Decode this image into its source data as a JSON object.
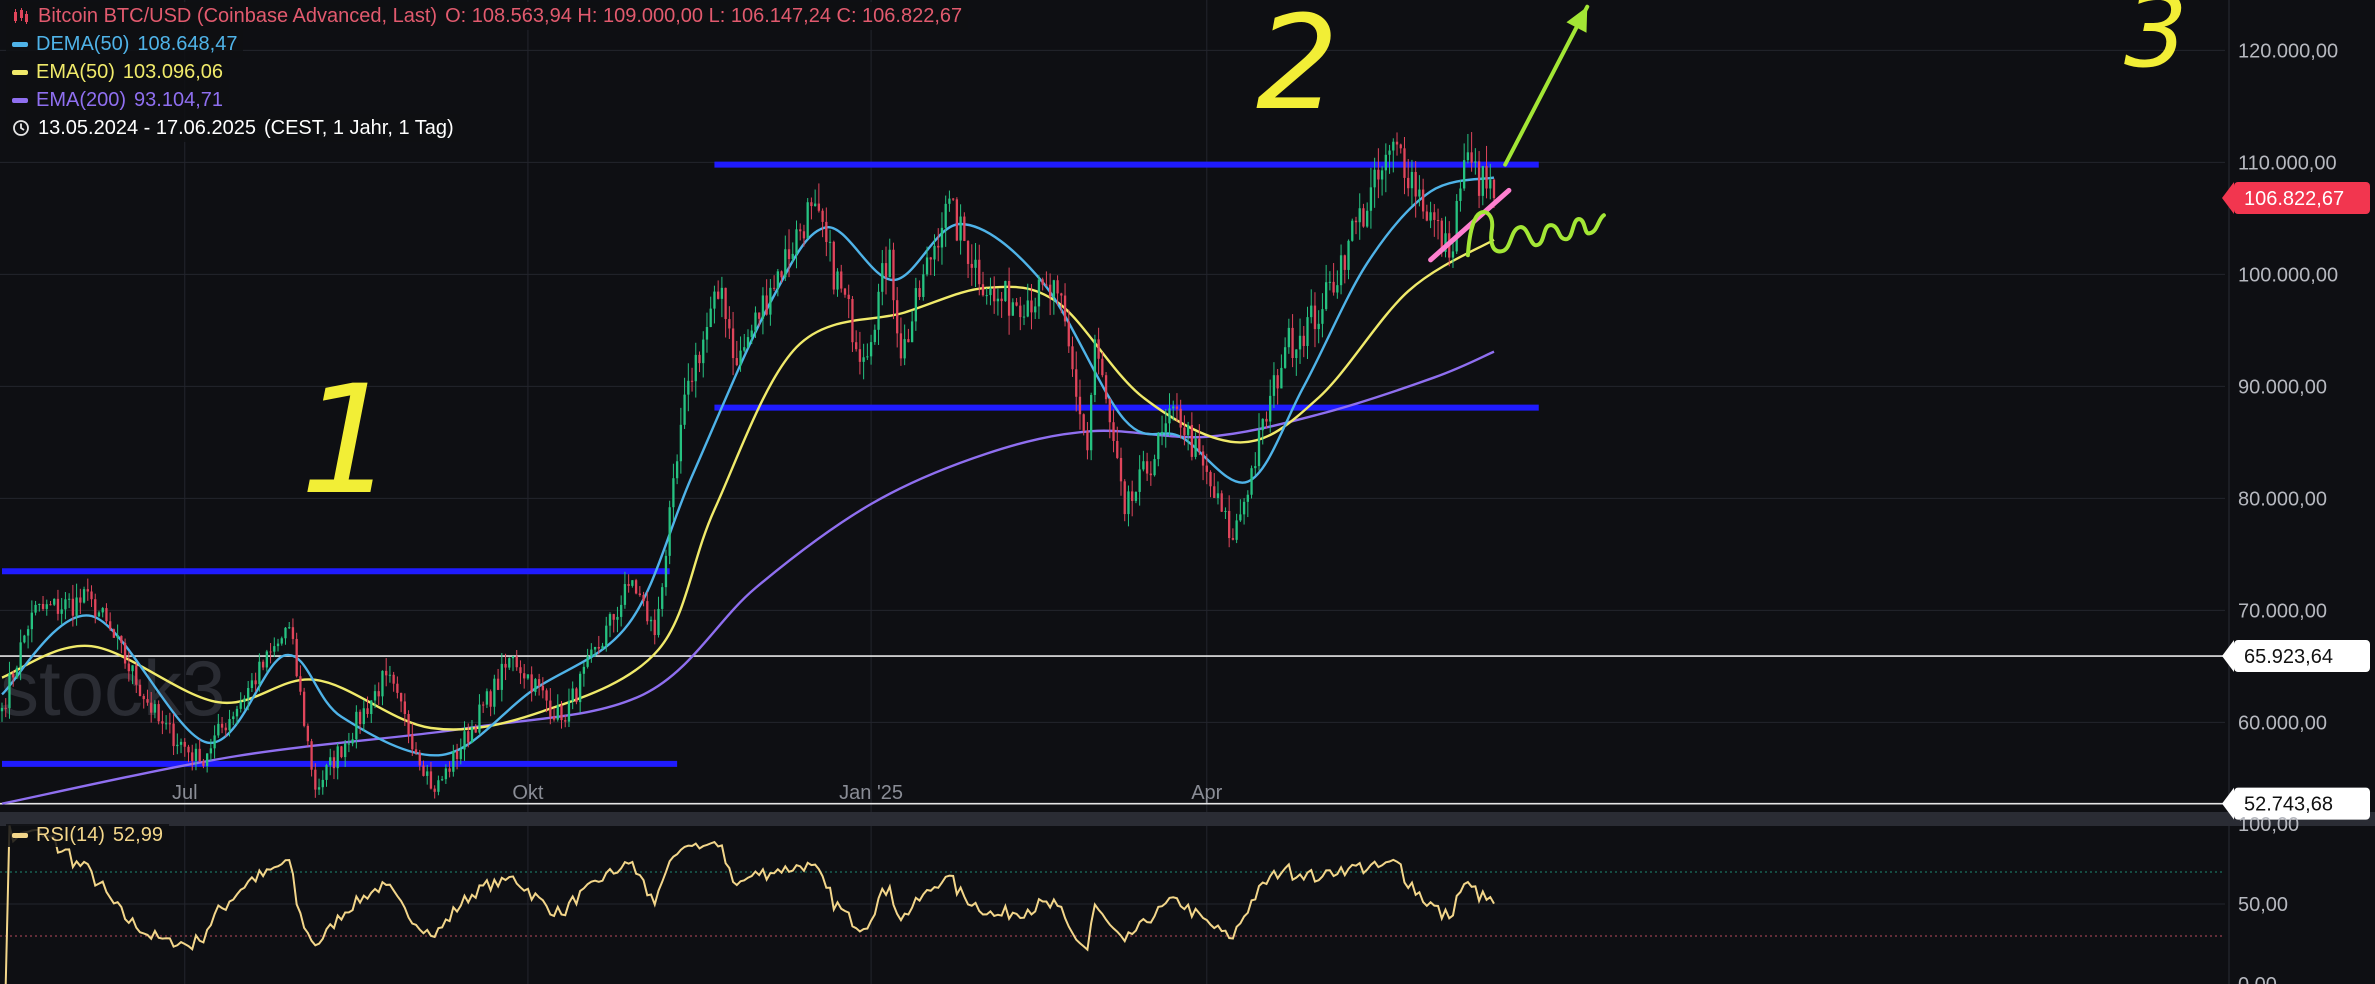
{
  "header": {
    "symbol": "Bitcoin BTC/USD (Coinbase Advanced, Last)",
    "ohlc": "O: 108.563,94  H: 109.000,00  L: 106.147,24  C: 106.822,67",
    "range": "13.05.2024 - 17.06.2025",
    "range_meta": "(CEST, 1 Jahr, 1 Tag)"
  },
  "indicators": [
    {
      "name": "DEMA(50)",
      "value": "108.648,47",
      "color": "#4fb3e8"
    },
    {
      "name": "EMA(50)",
      "value": "103.096,06",
      "color": "#f0ea6a"
    },
    {
      "name": "EMA(200)",
      "value": "93.104,71",
      "color": "#8f6ff0"
    }
  ],
  "rsi": {
    "name": "RSI(14)",
    "value": "52,99",
    "color": "#f3d68a"
  },
  "colors": {
    "up": "#26c281",
    "down": "#e0455b",
    "hline": "#1f1bff",
    "trend": "#ff7fd0",
    "arrow": "#a3e635"
  },
  "annotations": {
    "wave1": "1",
    "wave2": "2",
    "wave3": "3"
  },
  "watermark": "stock3",
  "chart_data": {
    "type": "candlestick",
    "title": "Bitcoin BTC/USD (Coinbase Advanced, Last)",
    "x_labels": [
      "Jul",
      "Okt",
      "Jan '25",
      "Apr"
    ],
    "y_labels": [
      "120.000,00",
      "110.000,00",
      "100.000,00",
      "90.000,00",
      "80.000,00",
      "70.000,00",
      "60.000,00"
    ],
    "ylim": [
      52000,
      124500
    ],
    "price_tags": [
      {
        "label": "106.822,67",
        "value": 106822.67,
        "highlight": true
      },
      {
        "label": "65.923,64",
        "value": 65923.64
      },
      {
        "label": "52.743,68",
        "value": 52743.68
      }
    ],
    "horizontal_levels": [
      {
        "value": 73500,
        "from": "2024-05-13",
        "to": "2024-11-08"
      },
      {
        "value": 56300,
        "from": "2024-05-13",
        "to": "2024-11-10"
      },
      {
        "value": 109800,
        "from": "2024-11-20",
        "to": "2025-06-29"
      },
      {
        "value": 88100,
        "from": "2024-11-20",
        "to": "2025-06-29"
      }
    ],
    "trendline": {
      "start": [
        "2025-05-31",
        101300
      ],
      "end": [
        "2025-06-21",
        107500
      ]
    },
    "arrow": {
      "start": [
        "2025-06-20",
        109800
      ],
      "end": [
        "2025-07-12",
        123900
      ]
    },
    "anchors": [
      {
        "date": "2024-05-13",
        "close": 61300
      },
      {
        "date": "2024-05-21",
        "close": 69800
      },
      {
        "date": "2024-06-06",
        "close": 71000
      },
      {
        "date": "2024-06-24",
        "close": 60100
      },
      {
        "date": "2024-07-05",
        "close": 56500
      },
      {
        "date": "2024-07-29",
        "close": 68500
      },
      {
        "date": "2024-08-05",
        "close": 54000
      },
      {
        "date": "2024-08-24",
        "close": 64200
      },
      {
        "date": "2024-09-06",
        "close": 53800
      },
      {
        "date": "2024-09-27",
        "close": 65900
      },
      {
        "date": "2024-10-10",
        "close": 60200
      },
      {
        "date": "2024-10-29",
        "close": 72700
      },
      {
        "date": "2024-11-04",
        "close": 67800
      },
      {
        "date": "2024-11-13",
        "close": 90500
      },
      {
        "date": "2024-11-22",
        "close": 98800
      },
      {
        "date": "2024-11-26",
        "close": 91900
      },
      {
        "date": "2024-12-05",
        "close": 98800
      },
      {
        "date": "2024-12-16",
        "close": 106100
      },
      {
        "date": "2024-12-30",
        "close": 92600
      },
      {
        "date": "2025-01-06",
        "close": 102200
      },
      {
        "date": "2025-01-09",
        "close": 92500
      },
      {
        "date": "2025-01-21",
        "close": 106300
      },
      {
        "date": "2025-02-03",
        "close": 97600
      },
      {
        "date": "2025-02-20",
        "close": 98300
      },
      {
        "date": "2025-02-28",
        "close": 84300
      },
      {
        "date": "2025-03-02",
        "close": 94200
      },
      {
        "date": "2025-03-10",
        "close": 78600
      },
      {
        "date": "2025-03-24",
        "close": 88000
      },
      {
        "date": "2025-04-08",
        "close": 76300
      },
      {
        "date": "2025-04-22",
        "close": 93500
      },
      {
        "date": "2025-05-02",
        "close": 96900
      },
      {
        "date": "2025-05-09",
        "close": 103000
      },
      {
        "date": "2025-05-22",
        "close": 111600
      },
      {
        "date": "2025-06-05",
        "close": 101500
      },
      {
        "date": "2025-06-09",
        "close": 110200
      },
      {
        "date": "2025-06-17",
        "close": 106822.67
      }
    ],
    "dema50_points": [
      {
        "date": "2024-05-13",
        "value": 62500
      },
      {
        "date": "2024-06-06",
        "value": 69500
      },
      {
        "date": "2024-07-07",
        "value": 58200
      },
      {
        "date": "2024-07-28",
        "value": 66000
      },
      {
        "date": "2024-08-12",
        "value": 60500
      },
      {
        "date": "2024-09-08",
        "value": 57100
      },
      {
        "date": "2024-10-02",
        "value": 62800
      },
      {
        "date": "2024-10-28",
        "value": 68800
      },
      {
        "date": "2024-11-14",
        "value": 82000
      },
      {
        "date": "2024-12-05",
        "value": 97500
      },
      {
        "date": "2024-12-20",
        "value": 104200
      },
      {
        "date": "2025-01-07",
        "value": 99500
      },
      {
        "date": "2025-01-25",
        "value": 104500
      },
      {
        "date": "2025-02-16",
        "value": 99300
      },
      {
        "date": "2025-03-10",
        "value": 87000
      },
      {
        "date": "2025-03-25",
        "value": 85500
      },
      {
        "date": "2025-04-12",
        "value": 81500
      },
      {
        "date": "2025-04-27",
        "value": 90000
      },
      {
        "date": "2025-05-14",
        "value": 101000
      },
      {
        "date": "2025-05-31",
        "value": 107400
      },
      {
        "date": "2025-06-17",
        "value": 108648.47
      }
    ],
    "ema50_points": [
      {
        "date": "2024-05-13",
        "value": 64000
      },
      {
        "date": "2024-06-06",
        "value": 66800
      },
      {
        "date": "2024-07-10",
        "value": 61800
      },
      {
        "date": "2024-08-05",
        "value": 63800
      },
      {
        "date": "2024-09-05",
        "value": 59500
      },
      {
        "date": "2024-10-05",
        "value": 61000
      },
      {
        "date": "2024-11-05",
        "value": 66500
      },
      {
        "date": "2024-11-20",
        "value": 79000
      },
      {
        "date": "2024-12-12",
        "value": 93500
      },
      {
        "date": "2025-01-10",
        "value": 96600
      },
      {
        "date": "2025-02-01",
        "value": 98800
      },
      {
        "date": "2025-02-20",
        "value": 97500
      },
      {
        "date": "2025-03-15",
        "value": 89000
      },
      {
        "date": "2025-04-10",
        "value": 85000
      },
      {
        "date": "2025-05-01",
        "value": 89000
      },
      {
        "date": "2025-05-25",
        "value": 98500
      },
      {
        "date": "2025-06-17",
        "value": 103096.06
      }
    ],
    "ema200_points": [
      {
        "date": "2024-05-13",
        "value": 52743.68
      },
      {
        "date": "2024-07-15",
        "value": 57000
      },
      {
        "date": "2024-09-15",
        "value": 59500
      },
      {
        "date": "2024-11-01",
        "value": 62500
      },
      {
        "date": "2024-12-01",
        "value": 72000
      },
      {
        "date": "2025-01-01",
        "value": 79500
      },
      {
        "date": "2025-02-01",
        "value": 84000
      },
      {
        "date": "2025-03-01",
        "value": 86000
      },
      {
        "date": "2025-04-01",
        "value": 85500
      },
      {
        "date": "2025-05-01",
        "value": 87500
      },
      {
        "date": "2025-06-01",
        "value": 90800
      },
      {
        "date": "2025-06-17",
        "value": 93104.71
      }
    ],
    "rsi_panel": {
      "y_labels": [
        "100,00",
        "50,00",
        "0,00"
      ],
      "ylim": [
        0,
        100
      ],
      "overbought": 70,
      "oversold": 30
    }
  }
}
